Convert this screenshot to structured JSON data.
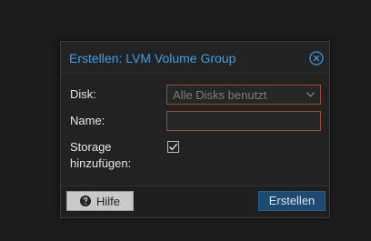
{
  "dialog": {
    "title": "Erstellen: LVM Volume Group",
    "close_icon": "close-circle-icon"
  },
  "form": {
    "disk_label": "Disk:",
    "disk_value": "Alle Disks benutzt",
    "name_label": "Name:",
    "name_value": "",
    "storage_label_line1": "Storage",
    "storage_label_line2": "hinzufügen:",
    "storage_checked": true
  },
  "footer": {
    "help_label": "Hilfe",
    "help_icon": "question-circle-icon",
    "create_label": "Erstellen"
  },
  "colors": {
    "title": "#3a9fe4",
    "invalid_border": "#a14c35",
    "primary_button": "#1d4a70"
  }
}
